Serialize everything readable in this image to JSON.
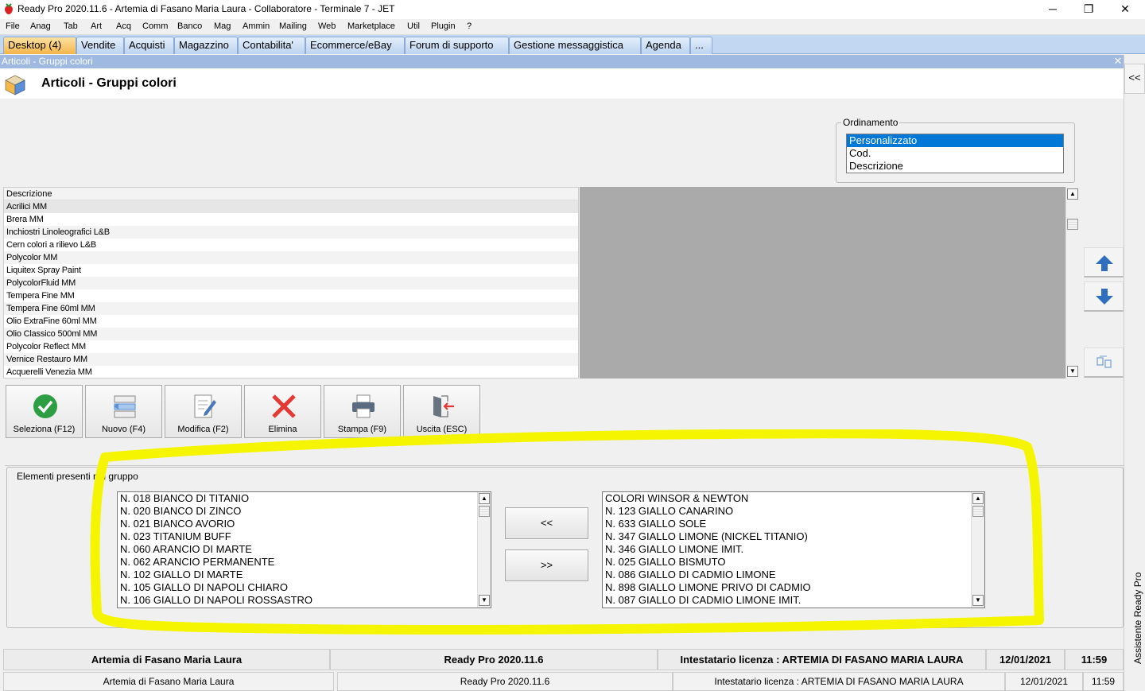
{
  "window": {
    "title": "Ready Pro 2020.11.6 - Artemia di Fasano Maria Laura - Collaboratore - Terminale 7 - JET",
    "minimize": "─",
    "maximize": "❐",
    "close": "✕"
  },
  "menu": [
    "File",
    "Anag",
    "Tab",
    "Art",
    "Acq",
    "Comm",
    "Banco",
    "Mag",
    "Ammin",
    "Mailing",
    "Web",
    "Marketplace",
    "Util",
    "Plugin",
    "?"
  ],
  "tabs": [
    "Desktop (4)",
    "Vendite",
    "Acquisti",
    "Magazzino",
    "Contabilita'",
    "Ecommerce/eBay",
    "Forum di supporto",
    "Gestione messaggistica",
    "Agenda",
    "..."
  ],
  "form": {
    "caption": "Articoli - Gruppi colori",
    "close": "✕",
    "title": "Articoli - Gruppi colori",
    "collapse": "<<"
  },
  "ordinamento": {
    "label": "Ordinamento",
    "options": [
      "Personalizzato",
      "Cod.",
      "Descrizione"
    ],
    "selected": 0
  },
  "grid": {
    "header": "Descrizione",
    "rows": [
      "Acrilici MM",
      "Brera MM",
      "Inchiostri Linoleografici L&B",
      "Cern colori a rilievo L&B",
      "Polycolor MM",
      "Liquitex Spray Paint",
      "PolycolorFluid MM",
      "Tempera Fine MM",
      "Tempera Fine 60ml MM",
      "Olio ExtraFine 60ml MM",
      "Olio Classico 500ml MM",
      "Polycolor Reflect MM",
      "Vernice Restauro MM",
      "Acquerelli Venezia MM"
    ]
  },
  "toolbar": {
    "seleziona": "Seleziona (F12)",
    "nuovo": "Nuovo (F4)",
    "modifica": "Modifica (F2)",
    "elimina": "Elimina",
    "stampa": "Stampa (F9)",
    "uscita": "Uscita (ESC)"
  },
  "group": {
    "label": "Elementi presenti nel gruppo",
    "left_items": [
      "N. 018 BIANCO DI TITANIO",
      "N. 020 BIANCO DI ZINCO",
      "N. 021 BIANCO AVORIO",
      "N. 023 TITANIUM BUFF",
      "N. 060 ARANCIO DI MARTE",
      "N. 062 ARANCIO PERMANENTE",
      "N. 102 GIALLO DI MARTE",
      "N. 105 GIALLO DI NAPOLI CHIARO",
      "N. 106 GIALLO DI NAPOLI ROSSASTRO"
    ],
    "right_items": [
      "COLORI WINSOR & NEWTON",
      "N. 123 GIALLO CANARINO",
      "N. 633 GIALLO SOLE",
      "N. 347 GIALLO LIMONE (NICKEL TITANIO)",
      "N. 346 GIALLO LIMONE IMIT.",
      "N. 025 GIALLO BISMUTO",
      "N. 086 GIALLO DI CADMIO LIMONE",
      "N. 898 GIALLO LIMONE PRIVO DI CADMIO",
      "N. 087 GIALLO DI CADMIO LIMONE IMIT."
    ],
    "add_label": "<<",
    "remove_label": ">>"
  },
  "status1": {
    "company": "Artemia di Fasano Maria Laura",
    "version": "Ready Pro 2020.11.6",
    "license": "Intestatario licenza : ARTEMIA DI FASANO MARIA LAURA",
    "date": "12/01/2021",
    "time": "11:59"
  },
  "status2": {
    "company": "Artemia di Fasano Maria Laura",
    "version": "Ready Pro 2020.11.6",
    "license": "Intestatario licenza : ARTEMIA DI FASANO MARIA LAURA",
    "date": "12/01/2021",
    "time": "11:59"
  },
  "assistant": "Assistente Ready Pro",
  "colors": {
    "accent": "#0078d7",
    "tab_active": "#f3b64b",
    "highlight": "#f5f500",
    "delete_red": "#e53935",
    "confirm_green": "#2e9e44"
  }
}
